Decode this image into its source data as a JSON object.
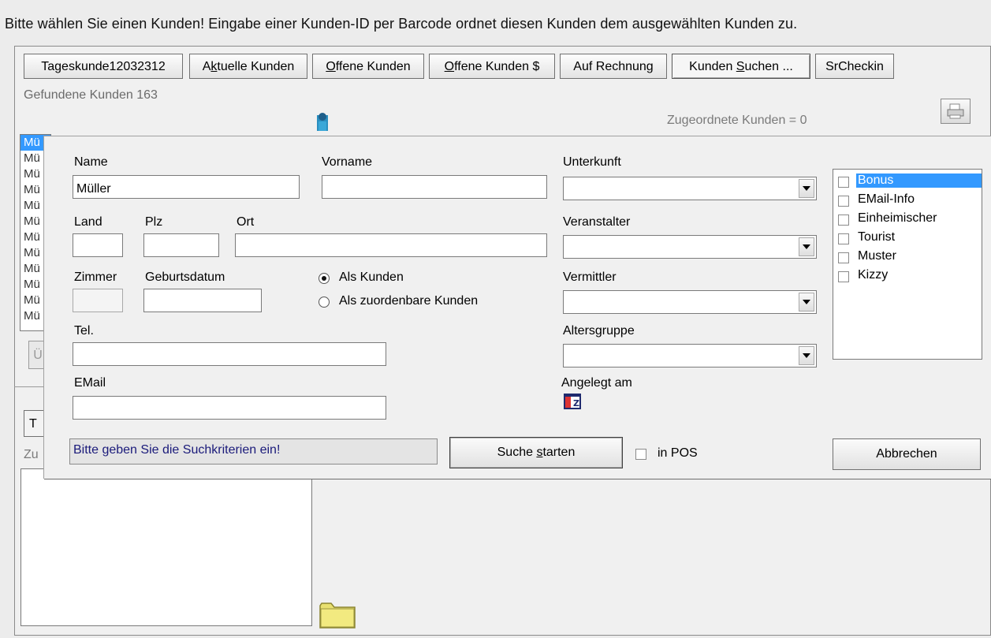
{
  "title": "Bitte wählen Sie einen Kunden! Eingabe einer Kunden-ID per Barcode ordnet diesen Kunden dem ausgewählten Kunden zu.",
  "tabs": [
    {
      "label": "Tageskunde12032312"
    },
    {
      "pre": "A",
      "ul": "k",
      "post": "tuelle Kunden"
    },
    {
      "pre": "",
      "ul": "O",
      "post": "ffene Kunden"
    },
    {
      "pre": "",
      "ul": "O",
      "post": "ffene Kunden $"
    },
    {
      "label": "Auf Rechnung"
    },
    {
      "pre": "Kunden ",
      "ul": "S",
      "post": "uchen ..."
    },
    {
      "label": "SrCheckin"
    }
  ],
  "found_customers": "Gefundene Kunden 163",
  "assigned_customers": "Zugeordnete Kunden = 0",
  "left_list": [
    "Mü",
    "Mü",
    "Mü",
    "Mü",
    "Mü",
    "Mü",
    "Mü",
    "Mü",
    "Mü",
    "Mü",
    "Mü",
    "Mü"
  ],
  "ghost_button_label": "Ü",
  "bottom_tab_label": "T",
  "bottom_label": "Zu",
  "dialog": {
    "name_label": "Name",
    "name_value": "Müller",
    "vorname_label": "Vorname",
    "vorname_value": "",
    "unterkunft_label": "Unterkunft",
    "land_label": "Land",
    "plz_label": "Plz",
    "ort_label": "Ort",
    "veranstalter_label": "Veranstalter",
    "zimmer_label": "Zimmer",
    "geburtsdatum_label": "Geburtsdatum",
    "radio_kunden": "Als Kunden",
    "radio_zuordenbar": "Als zuordenbare Kunden",
    "vermittler_label": "Vermittler",
    "tel_label": "Tel.",
    "altersgruppe_label": "Altersgruppe",
    "email_label": "EMail",
    "angelegt_label": "Angelegt am",
    "checklist": [
      "Bonus",
      "EMail-Info",
      "Einheimischer",
      "Tourist",
      "Muster",
      "Kizzy"
    ],
    "status": "Bitte geben Sie die Suchkriterien ein!",
    "search_pre": "Suche ",
    "search_ul": "s",
    "search_post": "tarten",
    "in_pos_label": "in POS",
    "cancel_label": "Abbrechen"
  },
  "colors": {
    "selection": "#3399ff",
    "status_text": "#1a1a7a"
  }
}
